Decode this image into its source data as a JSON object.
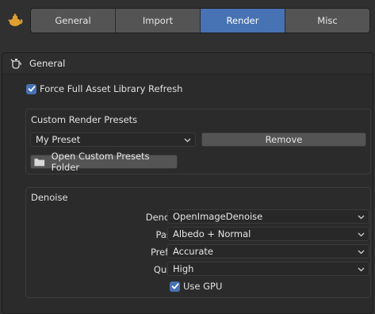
{
  "tabs": [
    {
      "label": "General",
      "active": false
    },
    {
      "label": "Import",
      "active": false
    },
    {
      "label": "Render",
      "active": true
    },
    {
      "label": "Misc",
      "active": false
    }
  ],
  "panel": {
    "title": "General",
    "force_refresh": {
      "label": "Force Full Asset Library Refresh",
      "checked": true
    }
  },
  "custom_presets": {
    "title": "Custom Render Presets",
    "preset_select": "My Preset",
    "remove_label": "Remove",
    "open_folder_label": "Open Custom Presets Folder"
  },
  "denoise": {
    "title": "Denoise",
    "fields": [
      {
        "label": "Denoiser",
        "value": "OpenImageDenoise"
      },
      {
        "label": "Passes",
        "value": "Albedo + Normal"
      },
      {
        "label": "Prefilter",
        "value": "Accurate"
      },
      {
        "label": "Quality",
        "value": "High"
      }
    ],
    "use_gpu": {
      "label": "Use GPU",
      "checked": true
    }
  },
  "colors": {
    "accent": "#4772b3",
    "background": "#303030",
    "panel": "#2b2b2b",
    "widget": "#545454",
    "field": "#282828"
  },
  "icons": {
    "app": "teapot-icon",
    "panel": "render-teapot-icon",
    "folder": "folder-icon",
    "chevron": "chevron-down-icon",
    "check": "checkmark-icon"
  }
}
